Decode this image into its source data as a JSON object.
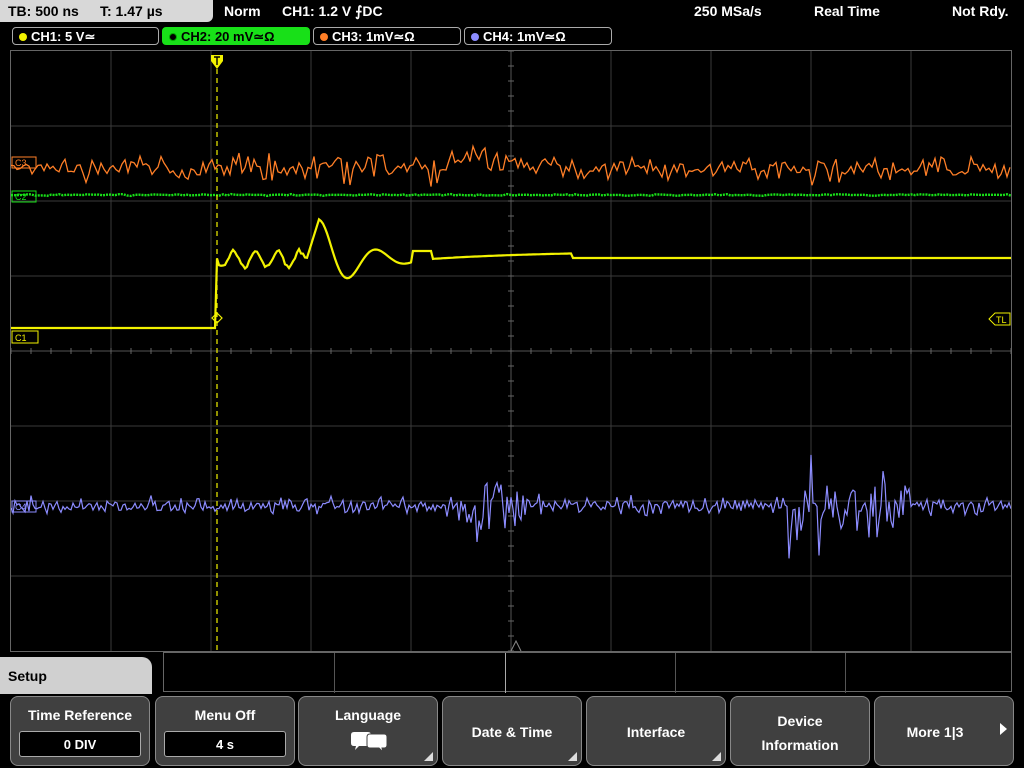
{
  "status": {
    "timebase": "TB: 500 ns",
    "trigger_time": "T: 1.47 µs",
    "mode": "Norm",
    "trigger_setting": "CH1: 1.2 V ⨍DC",
    "sample_rate": "250 MSa/s",
    "acq_mode": "Real Time",
    "ready_state": "Not Rdy."
  },
  "channels": [
    {
      "label": "CH1: 5 V≃",
      "color": "#f2f200"
    },
    {
      "label": "CH2: 20 mV≃Ω",
      "color": "#18e018"
    },
    {
      "label": "CH3: 1mV≃Ω",
      "color": "#ff7f27"
    },
    {
      "label": "CH4: 1mV≃Ω",
      "color": "#8c8cff"
    }
  ],
  "markers": {
    "ch1": "C1",
    "ch2": "C2",
    "ch3": "C3",
    "ch4": "C4",
    "trigger_level": "TL"
  },
  "menu": {
    "title": "Setup",
    "softkeys": [
      {
        "label": "Time Reference",
        "value": "0 DIV"
      },
      {
        "label": "Menu Off",
        "value": "4 s"
      },
      {
        "label": "Language",
        "icon": "speech-bubbles-icon"
      },
      {
        "label": "Date & Time"
      },
      {
        "label": "Interface"
      },
      {
        "label": "Device",
        "label2": "Information"
      },
      {
        "label": "More 1|3",
        "icon": "arrow-right-icon"
      }
    ]
  }
}
